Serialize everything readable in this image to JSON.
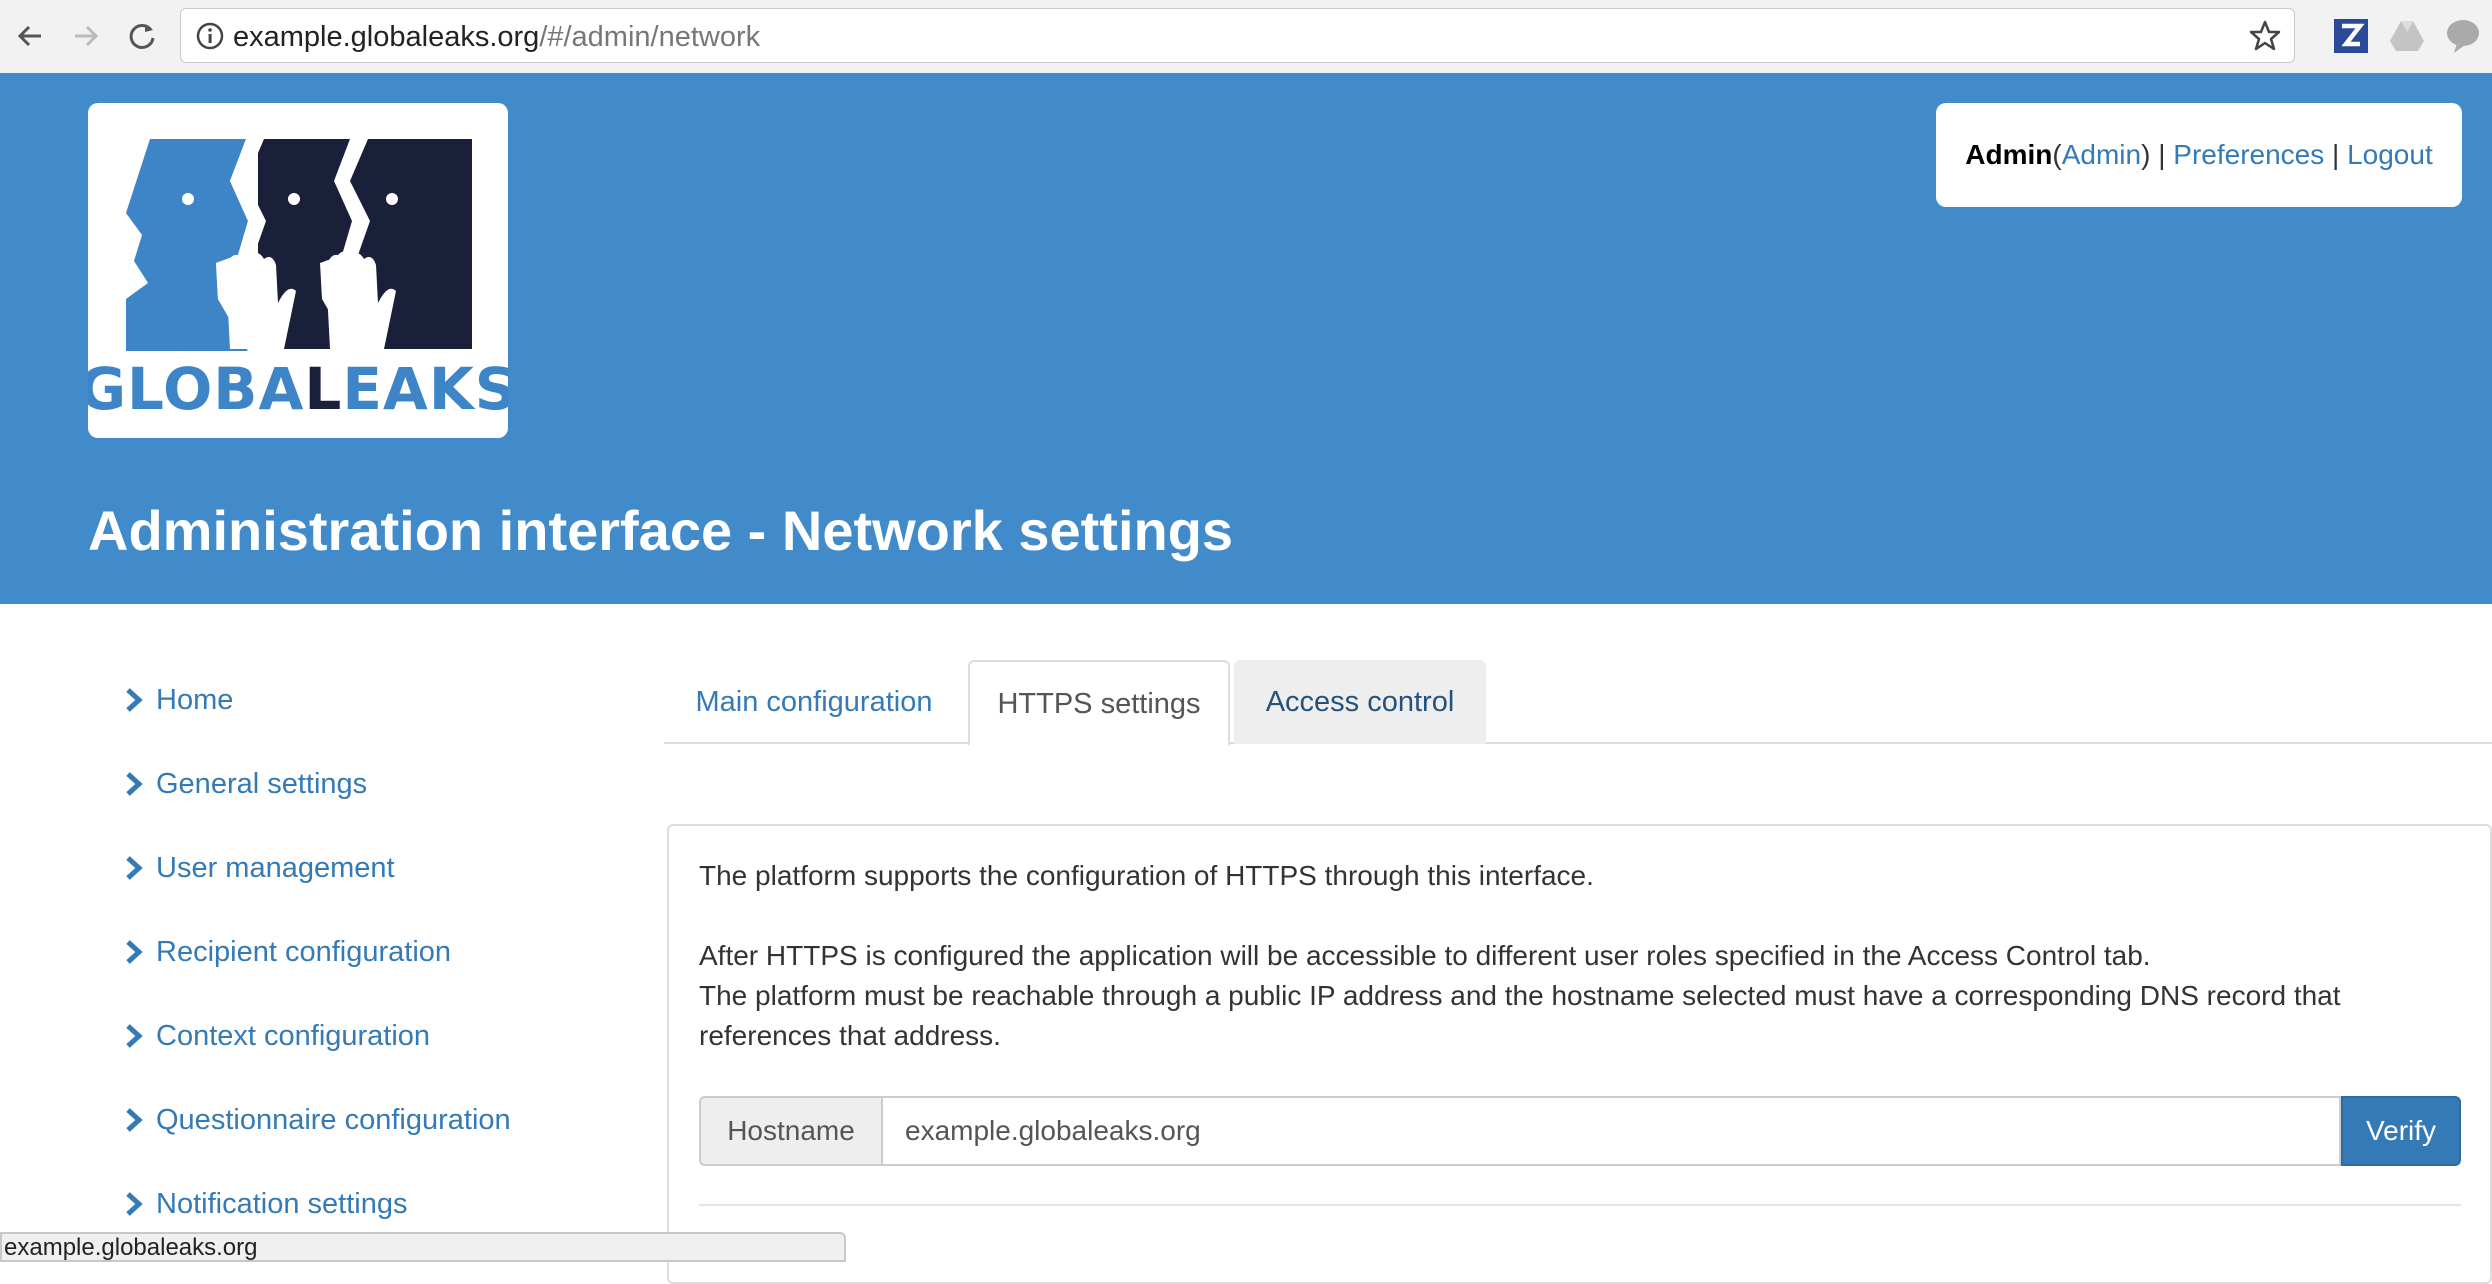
{
  "browser": {
    "url_host": "example.globaleaks.org",
    "url_path": "/#/admin/network",
    "back_icon": "arrow-left-icon",
    "forward_icon": "arrow-right-icon",
    "reload_icon": "reload-icon",
    "info_icon": "info-icon",
    "bookmark_icon": "star-icon",
    "extensions": [
      "zotero-icon",
      "drive-icon",
      "chat-bubble-icon"
    ]
  },
  "header": {
    "logo_text": "GLOBALEAKS",
    "title": "Administration interface - Network settings",
    "user": {
      "name": "Admin",
      "paren_open": " (",
      "role": "Admin",
      "paren_close": ")",
      "sep1": " | ",
      "preferences": "Preferences",
      "sep2": " | ",
      "logout": "Logout"
    }
  },
  "sidebar": {
    "items": [
      {
        "label": "Home"
      },
      {
        "label": "General settings"
      },
      {
        "label": "User management"
      },
      {
        "label": "Recipient configuration"
      },
      {
        "label": "Context configuration"
      },
      {
        "label": "Questionnaire configuration"
      },
      {
        "label": "Notification settings"
      }
    ]
  },
  "tabs": [
    {
      "label": "Main configuration"
    },
    {
      "label": "HTTPS settings",
      "active": true
    },
    {
      "label": "Access control"
    }
  ],
  "panel": {
    "intro": "The platform supports the configuration of HTTPS through this interface.",
    "line2": "After HTTPS is configured the application will be accessible to different user roles specified in the Access Control tab.",
    "line3": "The platform must be reachable through a public IP address and the hostname selected must have a corresponding DNS record that references that address.",
    "hostname_label": "Hostname",
    "hostname_value": "example.globaleaks.org",
    "verify_label": "Verify"
  },
  "status_bar": {
    "text": "example.globaleaks.org"
  },
  "colors": {
    "brand_blue": "#428bca",
    "link_blue": "#337ab7",
    "logo_dark": "#1a1f3a",
    "logo_light_blue": "#3d85c6"
  }
}
